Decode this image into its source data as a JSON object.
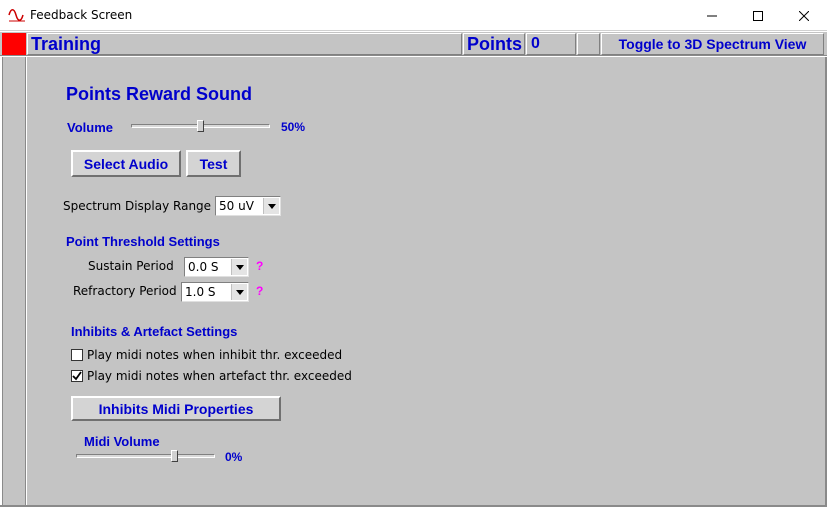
{
  "window": {
    "title": "Feedback Screen",
    "controls": {
      "minimize_icon": "minimize-icon",
      "maximize_icon": "maximize-icon",
      "close_icon": "close-icon"
    }
  },
  "header": {
    "training_label": "Training",
    "points_label": "Points",
    "points_value": "0",
    "toggle_label": "Toggle to 3D Spectrum View",
    "indicator_color": "#ff0000"
  },
  "reward_sound": {
    "title": "Points Reward Sound",
    "volume_label": "Volume",
    "volume_value": "50%",
    "volume_fraction": 0.5,
    "select_audio_label": "Select Audio",
    "test_label": "Test"
  },
  "spectrum": {
    "label": "Spectrum Display Range",
    "value": "50 uV"
  },
  "threshold": {
    "title": "Point Threshold Settings",
    "sustain_label": "Sustain Period",
    "sustain_value": "0.0 S",
    "refractory_label": "Refractory Period",
    "refractory_value": "1.0 S",
    "help": "?"
  },
  "inhibits": {
    "title": "Inhibits & Artefact Settings",
    "inhibit_checkbox_label": "Play midi notes when inhibit thr. exceeded",
    "inhibit_checked": false,
    "artefact_checkbox_label": "Play midi notes when artefact thr. exceeded",
    "artefact_checked": true,
    "midi_properties_label": "Inhibits Midi Properties",
    "midi_volume_label": "Midi Volume",
    "midi_volume_value": "0%",
    "midi_volume_fraction": 0.72
  },
  "colors": {
    "accent_blue": "#0000cc",
    "panel_grey": "#c4c4c4",
    "help_magenta": "#ff00ff"
  }
}
